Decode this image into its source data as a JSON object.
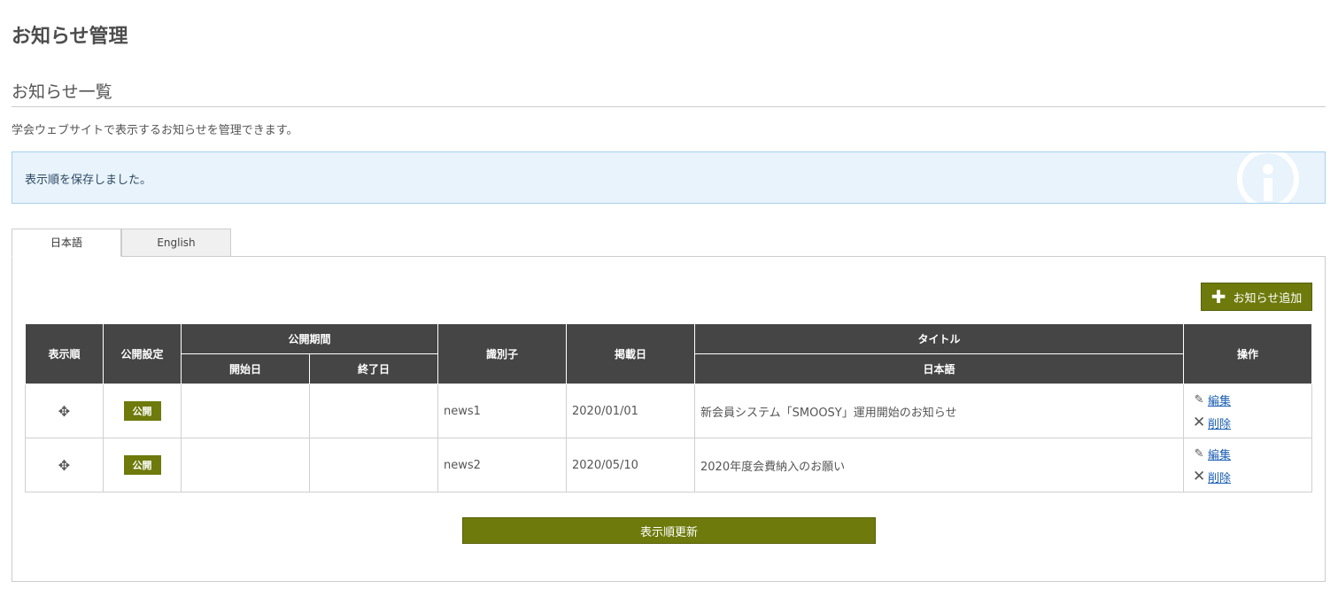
{
  "page": {
    "title": "お知らせ管理",
    "section_title": "お知らせ一覧",
    "description": "学会ウェブサイトで表示するお知らせを管理できます。"
  },
  "alert": {
    "message": "表示順を保存しました。",
    "icon": "info-icon"
  },
  "tabs": [
    {
      "label": "日本語",
      "active": true
    },
    {
      "label": "English",
      "active": false
    }
  ],
  "toolbar": {
    "add_label": "お知らせ追加",
    "add_icon": "plus-icon"
  },
  "table": {
    "headers": {
      "order": "表示順",
      "publish_setting": "公開設定",
      "period": "公開期間",
      "start_date": "開始日",
      "end_date": "終了日",
      "identifier": "識別子",
      "posted_date": "掲載日",
      "title": "タイトル",
      "title_ja": "日本語",
      "actions": "操作"
    },
    "rows": [
      {
        "status": "公開",
        "start": "",
        "end": "",
        "identifier": "news1",
        "date": "2020/01/01",
        "title": "新会員システム「SMOOSY」運用開始のお知らせ",
        "edit": "編集",
        "delete": "削除"
      },
      {
        "status": "公開",
        "start": "",
        "end": "",
        "identifier": "news2",
        "date": "2020/05/10",
        "title": "2020年度会費納入のお願い",
        "edit": "編集",
        "delete": "削除"
      }
    ]
  },
  "footer": {
    "update_order_label": "表示順更新"
  },
  "colors": {
    "accent": "#6e7a0b",
    "header_bg": "#454545",
    "alert_bg": "#e8f3fc",
    "link": "#1a5fb4"
  }
}
